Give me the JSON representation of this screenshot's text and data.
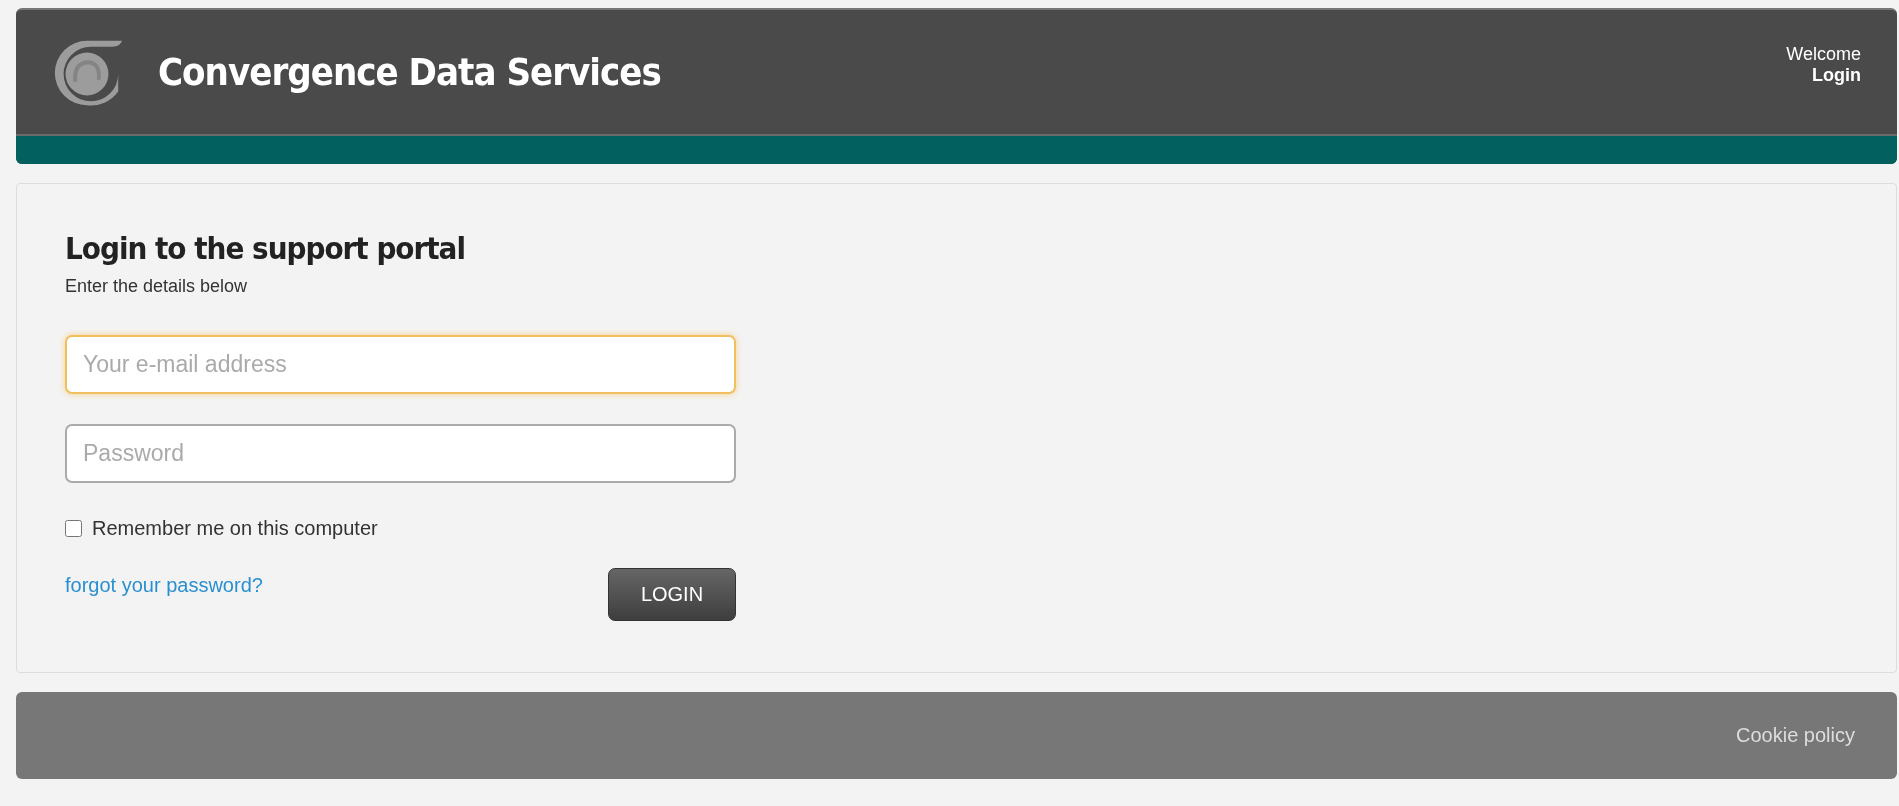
{
  "header": {
    "brand": "Convergence Data Services",
    "welcome": "Welcome",
    "login_link": "Login"
  },
  "login_form": {
    "title": "Login to the support portal",
    "subtitle": "Enter the details below",
    "fields": [
      {
        "placeholder": "Your e-mail address",
        "focused": true
      },
      {
        "placeholder": "Password",
        "focused": false
      }
    ],
    "remember": {
      "label": "Remember me on this computer",
      "checked": false
    },
    "forgot_link": "forgot your password?",
    "submit": "LOGIN"
  },
  "footer": {
    "link": "Cookie policy"
  }
}
